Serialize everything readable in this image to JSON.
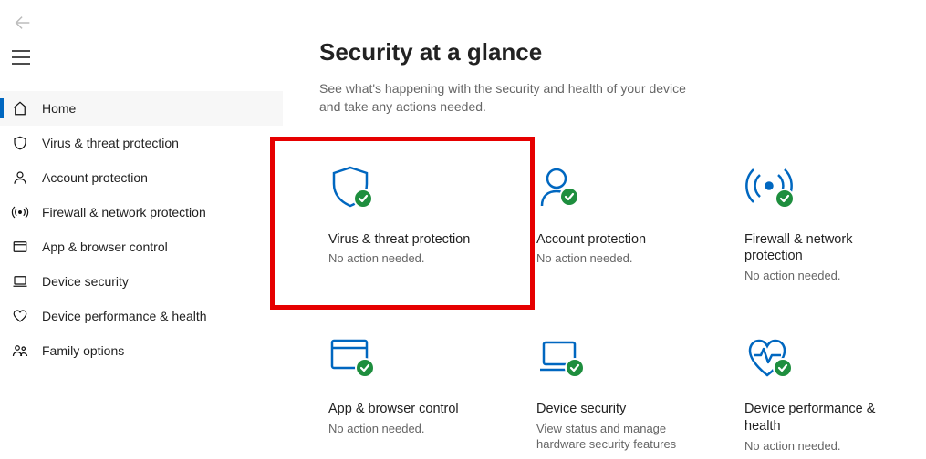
{
  "sidebar": {
    "items": [
      {
        "label": "Home"
      },
      {
        "label": "Virus & threat protection"
      },
      {
        "label": "Account protection"
      },
      {
        "label": "Firewall & network protection"
      },
      {
        "label": "App & browser control"
      },
      {
        "label": "Device security"
      },
      {
        "label": "Device performance & health"
      },
      {
        "label": "Family options"
      }
    ]
  },
  "main": {
    "title": "Security at a glance",
    "subtitle": "See what's happening with the security and health of your device and take any actions needed."
  },
  "cards": [
    {
      "title": "Virus & threat protection",
      "status": "No action needed."
    },
    {
      "title": "Account protection",
      "status": "No action needed."
    },
    {
      "title": "Firewall & network protection",
      "status": "No action needed."
    },
    {
      "title": "App & browser control",
      "status": "No action needed."
    },
    {
      "title": "Device security",
      "status": "View status and manage hardware security features"
    },
    {
      "title": "Device performance & health",
      "status": "No action needed."
    }
  ],
  "colors": {
    "accent": "#0067c0",
    "ok": "#1e8e3e",
    "highlight": "#e60000"
  }
}
